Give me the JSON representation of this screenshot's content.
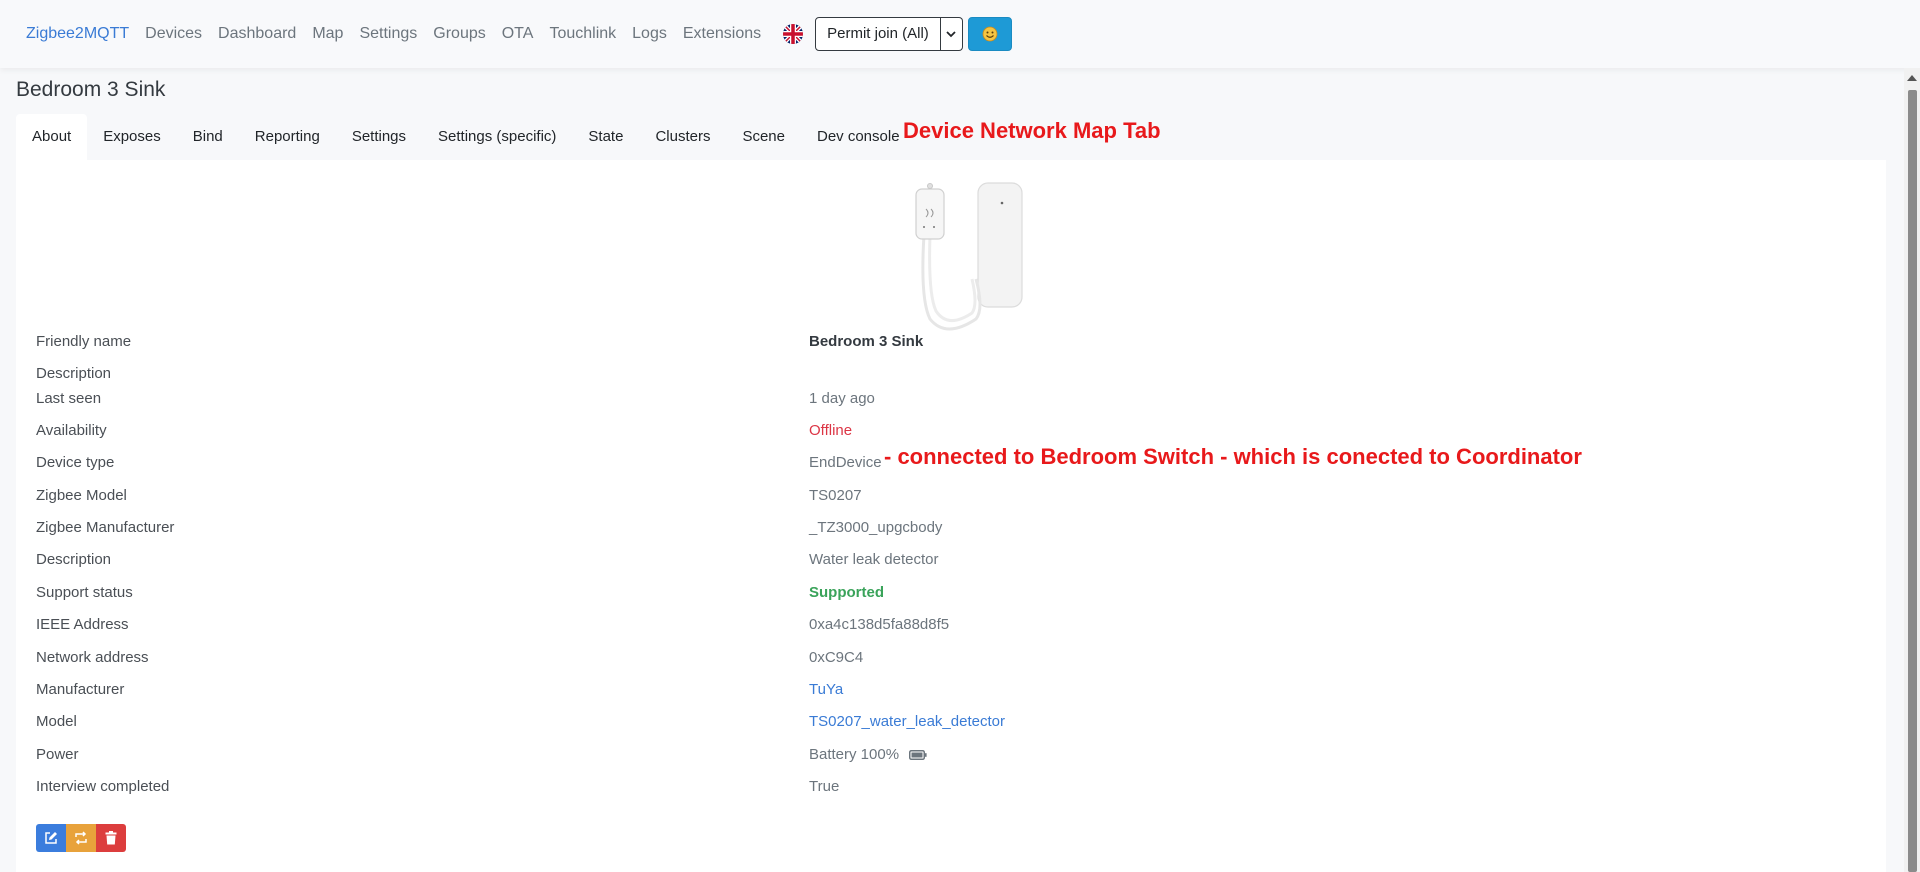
{
  "navbar": {
    "brand": "Zigbee2MQTT",
    "items": [
      "Devices",
      "Dashboard",
      "Map",
      "Settings",
      "Groups",
      "OTA",
      "Touchlink",
      "Logs",
      "Extensions"
    ],
    "permit_join": "Permit join (All)"
  },
  "page": {
    "title": "Bedroom 3 Sink"
  },
  "tabs": [
    "About",
    "Exposes",
    "Bind",
    "Reporting",
    "Settings",
    "Settings (specific)",
    "State",
    "Clusters",
    "Scene",
    "Dev console"
  ],
  "annotations": {
    "tab_note": "Device Network Map Tab",
    "connection_note": "- connected to Bedroom Switch - which is conected to Coordinator"
  },
  "details": {
    "friendly_name": {
      "label": "Friendly name",
      "value": "Bedroom 3 Sink"
    },
    "description_top": {
      "label": "Description",
      "value": ""
    },
    "last_seen": {
      "label": "Last seen",
      "value": "1 day ago"
    },
    "availability": {
      "label": "Availability",
      "value": "Offline"
    },
    "device_type": {
      "label": "Device type",
      "value": "EndDevice"
    },
    "zigbee_model": {
      "label": "Zigbee Model",
      "value": "TS0207"
    },
    "zigbee_manufacturer": {
      "label": "Zigbee Manufacturer",
      "value": "_TZ3000_upgcbody"
    },
    "description": {
      "label": "Description",
      "value": "Water leak detector"
    },
    "support_status": {
      "label": "Support status",
      "value": "Supported"
    },
    "ieee_address": {
      "label": "IEEE Address",
      "value": "0xa4c138d5fa88d8f5"
    },
    "network_address": {
      "label": "Network address",
      "value": "0xC9C4"
    },
    "manufacturer": {
      "label": "Manufacturer",
      "value": "TuYa"
    },
    "model": {
      "label": "Model",
      "value": "TS0207_water_leak_detector"
    },
    "power": {
      "label": "Power",
      "value": "Battery 100%"
    },
    "interview_completed": {
      "label": "Interview completed",
      "value": "True"
    }
  },
  "colors": {
    "brand": "#3a7bd5",
    "annotation": "#e8191b",
    "offline": "#dc3545",
    "supported": "#3aa35a",
    "edit_button": "#3b7ddd",
    "reconfigure_button": "#e8a23b",
    "delete_button": "#dc3d3d"
  },
  "icons": {
    "language": "uk-flag-icon",
    "theme": "smiley-icon",
    "battery": "battery-full-icon",
    "edit": "edit-icon",
    "reconfigure": "refresh-icon",
    "delete": "trash-icon"
  }
}
